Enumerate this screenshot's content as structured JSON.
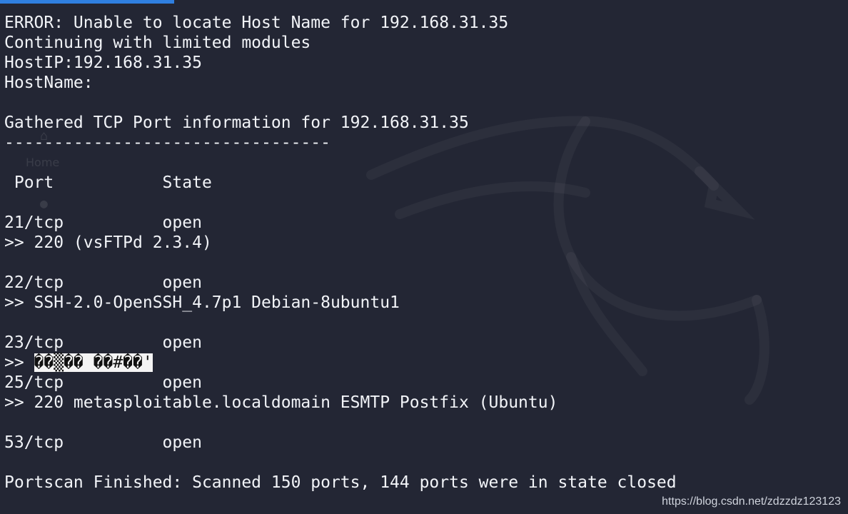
{
  "terminal": {
    "lines": [
      "ERROR: Unable to locate Host Name for 192.168.31.35",
      "Continuing with limited modules",
      "HostIP:192.168.31.35",
      "HostName:",
      "",
      "Gathered TCP Port information for 192.168.31.35",
      "---------------------------------",
      "",
      " Port           State",
      "",
      "21/tcp          open",
      ">> 220 (vsFTPd 2.3.4)",
      "",
      "22/tcp          open",
      ">> SSH-2.0-OpenSSH_4.7p1 Debian-8ubuntu1",
      "",
      "23/tcp          open",
      "",
      "25/tcp          open",
      ">> 220 metasploitable.localdomain ESMTP Postfix (Ubuntu)",
      "",
      "53/tcp          open",
      "",
      "Portscan Finished: Scanned 150 ports, 144 ports were in state closed"
    ],
    "garbled_prefix": ">> ",
    "garbled_text": "��▒�� ��#��'"
  },
  "background": {
    "ghost_label": "Home"
  },
  "watermark": "https://blog.csdn.net/zdzzdz123123",
  "colors": {
    "background": "#232634",
    "text": "#f2f4f8",
    "accent": "#2f7fe0"
  }
}
